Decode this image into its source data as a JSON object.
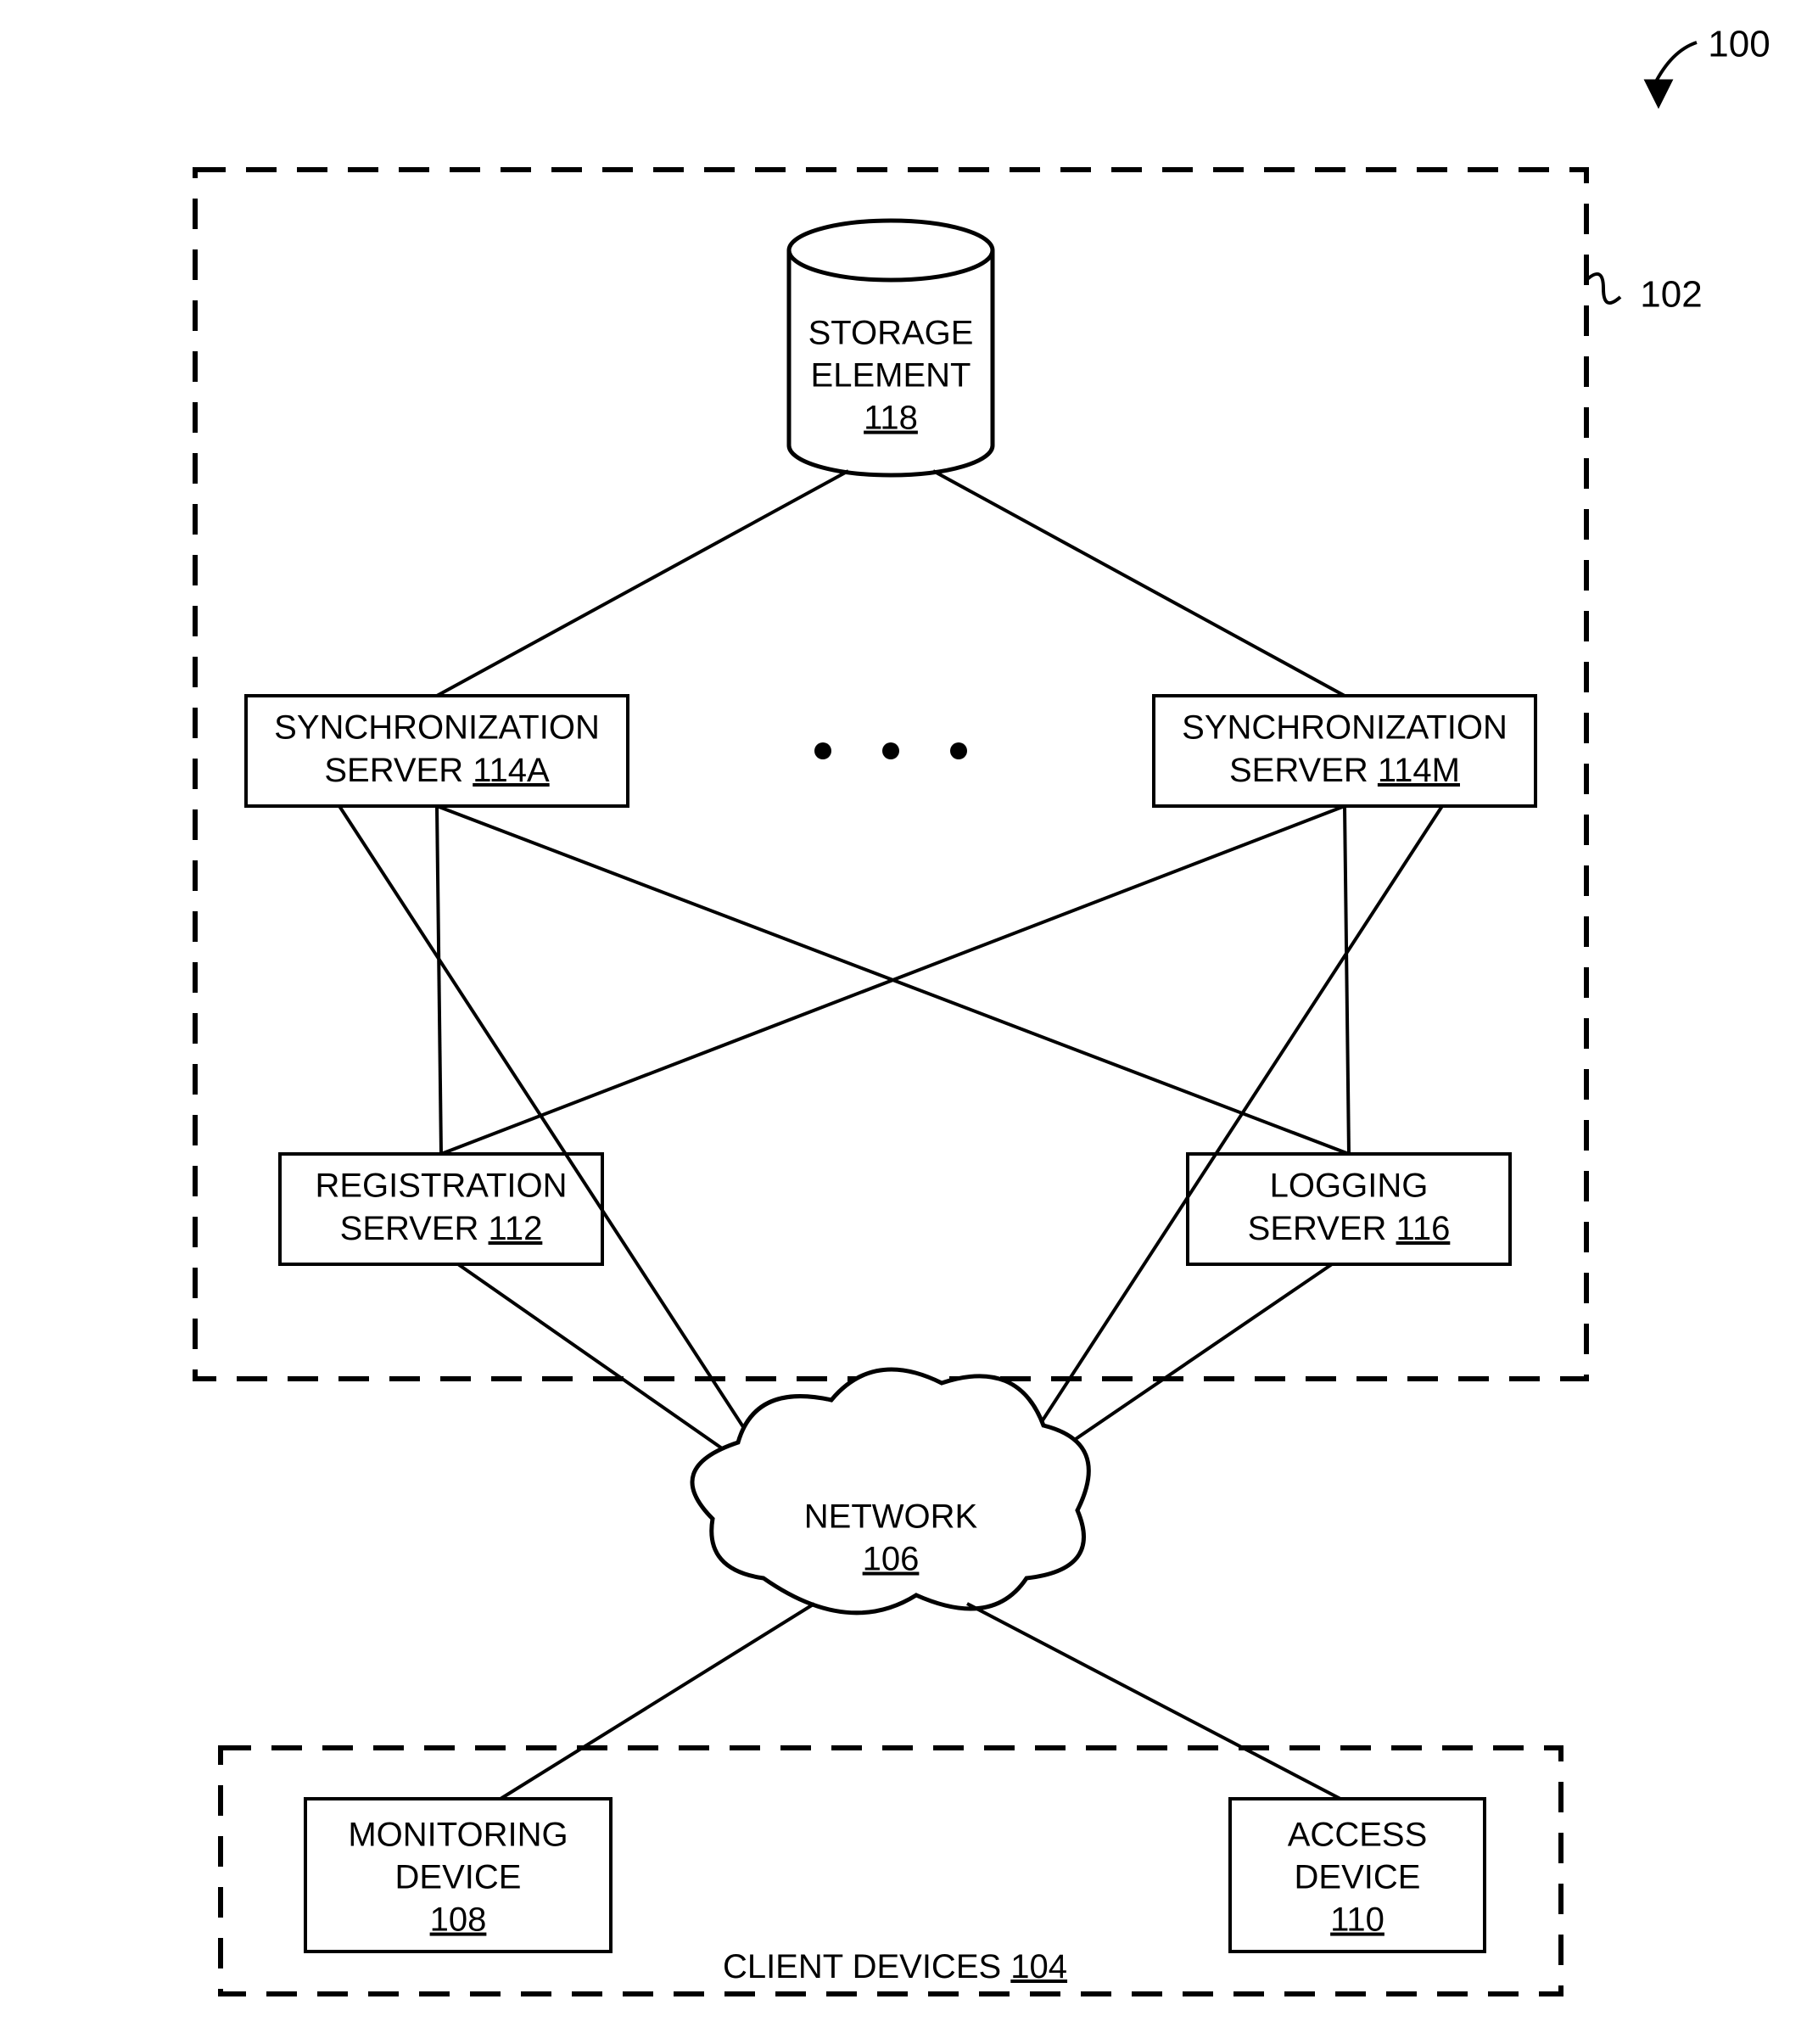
{
  "figure_ref": "100",
  "server_group_ref": "102",
  "storage": {
    "label1": "STORAGE",
    "label2": "ELEMENT",
    "ref": "118"
  },
  "sync_a": {
    "label1": "SYNCHRONIZATION",
    "label2_pre": "SERVER ",
    "ref": "114A"
  },
  "sync_m": {
    "label1": "SYNCHRONIZATION",
    "label2_pre": "SERVER ",
    "ref": "114M"
  },
  "reg": {
    "label1": "REGISTRATION",
    "label2_pre": "SERVER ",
    "ref": "112"
  },
  "log": {
    "label1": "LOGGING",
    "label2_pre": "SERVER ",
    "ref": "116"
  },
  "network": {
    "label": "NETWORK",
    "ref": "106"
  },
  "mon": {
    "label1": "MONITORING",
    "label2": "DEVICE",
    "ref": "108"
  },
  "acc": {
    "label1": "ACCESS",
    "label2": "DEVICE",
    "ref": "110"
  },
  "clients": {
    "label_pre": "CLIENT DEVICES ",
    "ref": "104"
  }
}
